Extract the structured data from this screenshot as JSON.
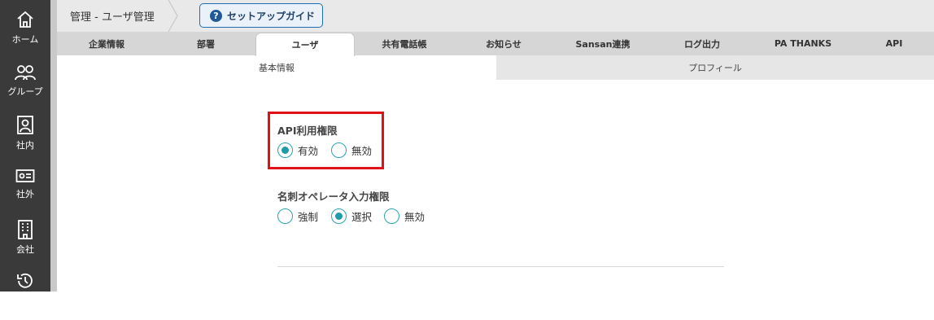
{
  "sidebar": {
    "items": [
      {
        "label": "ホーム",
        "icon": "home-icon"
      },
      {
        "label": "グループ",
        "icon": "group-icon"
      },
      {
        "label": "社内",
        "icon": "internal-contacts-icon"
      },
      {
        "label": "社外",
        "icon": "business-card-icon"
      },
      {
        "label": "会社",
        "icon": "building-icon"
      },
      {
        "label": "",
        "icon": "history-icon"
      }
    ]
  },
  "header": {
    "breadcrumb": "管理 - ユーザ管理",
    "guide_button": "セットアップガイド"
  },
  "tabs": [
    {
      "label": "企業情報"
    },
    {
      "label": "部署"
    },
    {
      "label": "ユーザ",
      "active": true
    },
    {
      "label": "共有電話帳"
    },
    {
      "label": "お知らせ"
    },
    {
      "label": "Sansan連携"
    },
    {
      "label": "ログ出力"
    },
    {
      "label": "PA THANKS"
    },
    {
      "label": "API"
    }
  ],
  "subtabs": [
    {
      "label": "基本情報",
      "active": true
    },
    {
      "label": "プロフィール"
    }
  ],
  "api_permission": {
    "title": "API利用権限",
    "options": [
      {
        "label": "有効",
        "checked": true
      },
      {
        "label": "無効",
        "checked": false
      }
    ]
  },
  "card_operator_permission": {
    "title": "名刺オペレータ入力権限",
    "options": [
      {
        "label": "強制",
        "checked": false
      },
      {
        "label": "選択",
        "checked": true
      },
      {
        "label": "無効",
        "checked": false
      }
    ]
  },
  "colors": {
    "sidebar": "#3a3a3a",
    "accent": "#1f9aa8",
    "highlight": "#e0101a",
    "guide_border": "#1f6eb3"
  }
}
